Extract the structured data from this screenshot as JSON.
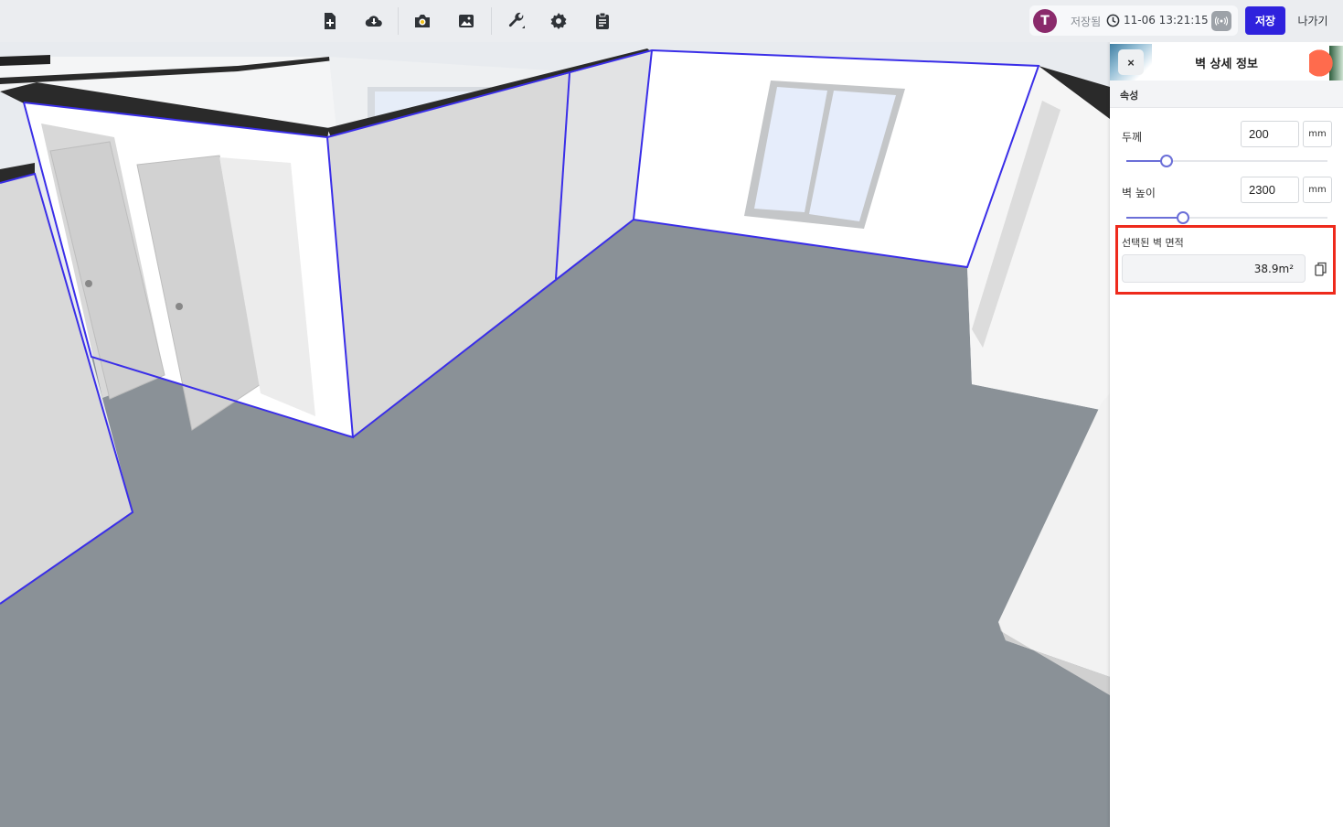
{
  "toolbar": {
    "icons": [
      "new-file-icon",
      "cloud-download-icon",
      "camera-icon",
      "image-icon",
      "wrench-icon",
      "gear-icon",
      "clipboard-icon"
    ]
  },
  "status": {
    "avatar_initial": "T",
    "saved_label": "저장됨",
    "saved_time": "11-06 13:21:15"
  },
  "actions": {
    "save_label": "저장",
    "exit_label": "나가기"
  },
  "panel": {
    "title": "벽 상세 정보",
    "close_label": "×",
    "section_title": "속성",
    "thickness": {
      "label": "두께",
      "value": "200",
      "unit": "mm",
      "slider_fraction": 0.2
    },
    "height": {
      "label": "벽 높이",
      "value": "2300",
      "unit": "mm",
      "slider_fraction": 0.28
    },
    "area": {
      "label": "선택된 벽 면적",
      "value": "38.9m²"
    }
  },
  "colors": {
    "accent": "#2f22dd",
    "wall_outline": "#3a2ee8",
    "highlight": "#ee2a1c",
    "floor": "#8a9197"
  }
}
